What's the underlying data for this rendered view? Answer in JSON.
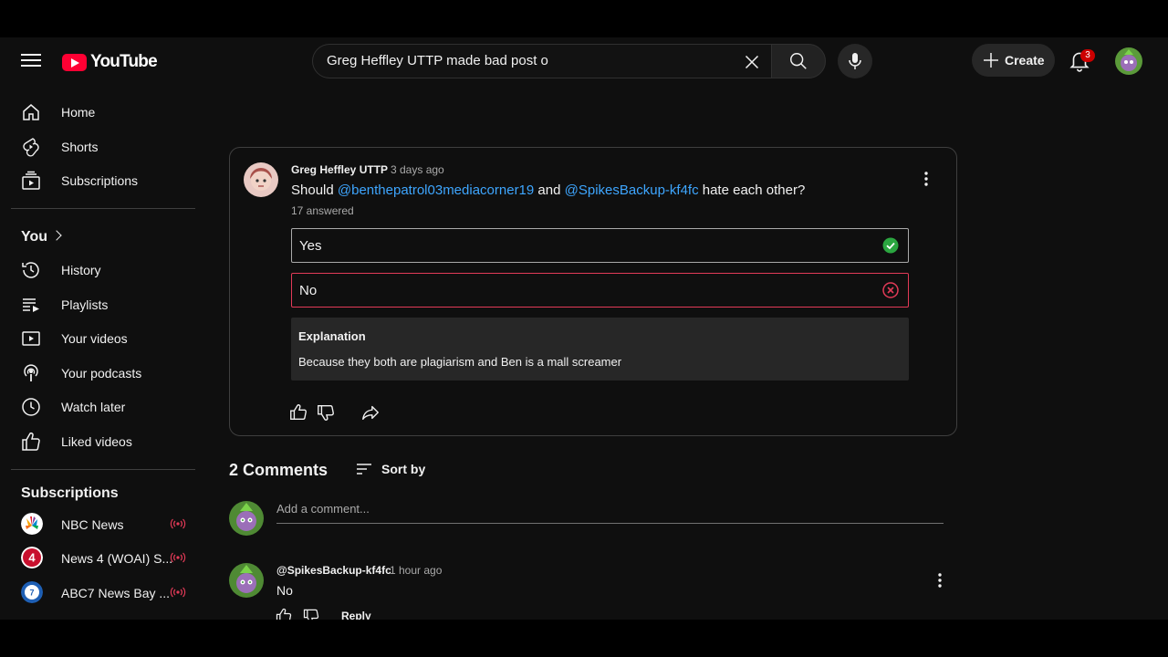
{
  "header": {
    "logo_text": "YouTube",
    "search_value": "Greg Heffley UTTP made bad post o",
    "create_label": "Create",
    "notification_count": "3"
  },
  "sidebar": {
    "items": [
      {
        "label": "Home",
        "icon": "home-icon"
      },
      {
        "label": "Shorts",
        "icon": "shorts-icon"
      },
      {
        "label": "Subscriptions",
        "icon": "subscriptions-icon"
      }
    ],
    "you_title": "You",
    "you_items": [
      {
        "label": "History",
        "icon": "history-icon"
      },
      {
        "label": "Playlists",
        "icon": "playlists-icon"
      },
      {
        "label": "Your videos",
        "icon": "your-videos-icon"
      },
      {
        "label": "Your podcasts",
        "icon": "podcasts-icon"
      },
      {
        "label": "Watch later",
        "icon": "watch-later-icon"
      },
      {
        "label": "Liked videos",
        "icon": "liked-videos-icon"
      }
    ],
    "subscriptions_title": "Subscriptions",
    "channels": [
      {
        "name": "NBC News",
        "live": true
      },
      {
        "name": "News 4 (WOAI) S...",
        "live": true
      },
      {
        "name": "ABC7 News Bay ...",
        "live": true
      }
    ]
  },
  "post": {
    "author": "Greg Heffley UTTP",
    "time": "3 days ago",
    "text_before": "Should ",
    "mention_1": "@benthepatrol03mediacorner19",
    "text_middle": " and ",
    "mention_2": "@SpikesBackup-kf4fc",
    "text_after": " hate each other?",
    "answered": "17 answered",
    "options": [
      {
        "label": "Yes",
        "state": "correct"
      },
      {
        "label": "No",
        "state": "incorrect"
      }
    ],
    "explanation_title": "Explanation",
    "explanation_text": "Because they both are plagiarism and Ben is a mall screamer"
  },
  "comments": {
    "count_label": "2 Comments",
    "sort_label": "Sort by",
    "add_placeholder": "Add a comment...",
    "items": [
      {
        "author": "@SpikesBackup-kf4fc",
        "time": "1 hour ago",
        "text": "No",
        "reply_label": "Reply"
      }
    ]
  },
  "colors": {
    "background": "#0f0f0f",
    "accent_red": "#ff0033",
    "link_blue": "#3ea6ff",
    "correct_green": "#2ba640",
    "incorrect_red": "#e23a57"
  }
}
